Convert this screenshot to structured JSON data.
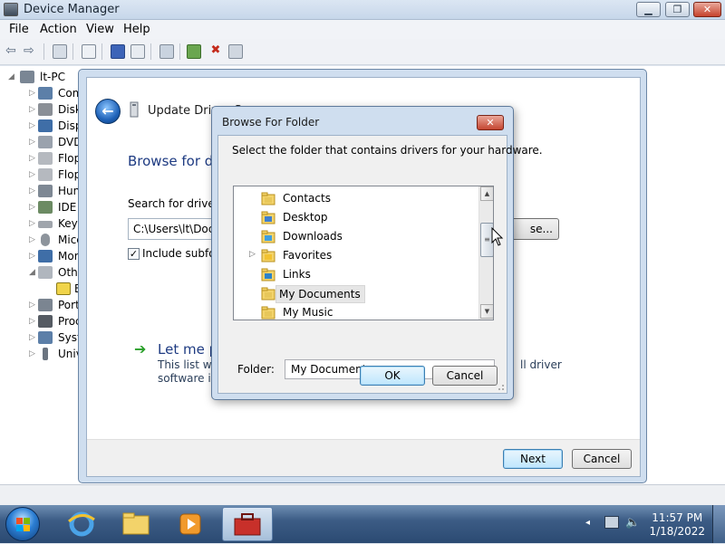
{
  "device_manager": {
    "title": "Device Manager",
    "menu": [
      "File",
      "Action",
      "View",
      "Help"
    ],
    "tree_root": "lt-PC",
    "tree_items": [
      "Com",
      "Disk",
      "Disp",
      "DVD",
      "Flop",
      "Flop",
      "Hun",
      "IDE A",
      "Keyb",
      "Mice",
      "Mor",
      "Othe",
      "E",
      "Port",
      "Proc",
      "Syst",
      "Univ"
    ]
  },
  "wizard": {
    "close_label": "✕",
    "title": "Update Driver So",
    "heading": "Browse for driv",
    "search_label": "Search for driver so",
    "path_value": "C:\\Users\\lt\\Docum",
    "browse_label": "se...",
    "include_subfolders": "Include subfolde",
    "include_subfolders_checked": true,
    "letme_title": "Let me pic",
    "letme_desc_line1": "This list will s",
    "letme_desc_line2": "software in th",
    "letme_desc_right": "ll driver",
    "next_label": "Next",
    "cancel_label": "Cancel"
  },
  "browse_dialog": {
    "title": "Browse For Folder",
    "close_label": "✕",
    "instruction": "Select the folder that contains drivers for your hardware.",
    "folders": [
      {
        "label": "Contacts",
        "expandable": false,
        "selected": false,
        "icon": "contacts-folder-icon"
      },
      {
        "label": "Desktop",
        "expandable": false,
        "selected": false,
        "icon": "desktop-folder-icon"
      },
      {
        "label": "Downloads",
        "expandable": false,
        "selected": false,
        "icon": "downloads-folder-icon"
      },
      {
        "label": "Favorites",
        "expandable": true,
        "selected": false,
        "icon": "favorites-folder-icon"
      },
      {
        "label": "Links",
        "expandable": false,
        "selected": false,
        "icon": "links-folder-icon"
      },
      {
        "label": "My Documents",
        "expandable": false,
        "selected": true,
        "icon": "documents-folder-icon"
      },
      {
        "label": "My Music",
        "expandable": false,
        "selected": false,
        "icon": "music-folder-icon"
      }
    ],
    "folder_label": "Folder:",
    "folder_value": "My Documents",
    "ok_label": "OK",
    "cancel_label": "Cancel"
  },
  "taskbar": {
    "time": "11:57 PM",
    "date": "1/18/2022"
  },
  "colors": {
    "link_blue": "#1e3b82",
    "taskbar": "#2b4a72",
    "selection": "#e6e6e6"
  }
}
